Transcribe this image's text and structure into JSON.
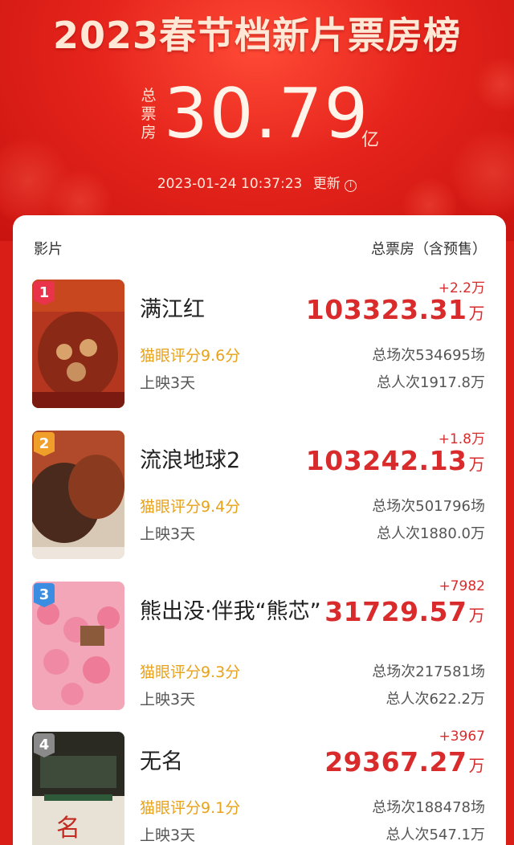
{
  "header": {
    "title": "2023春节档新片票房榜",
    "total_label": "总票房",
    "total_value": "30.79",
    "total_unit": "亿",
    "timestamp": "2023-01-24  10:37:23",
    "update_label": "更新",
    "info_glyph": "i"
  },
  "table": {
    "col_film": "影片",
    "col_box": "总票房（含预售）"
  },
  "movies": [
    {
      "rank": "1",
      "name": "满江红",
      "rating": "猫眼评分9.6分",
      "days": "上映3天",
      "delta": "+2.2万",
      "box": "103323.31",
      "box_unit": "万",
      "showings": "总场次534695场",
      "admissions": "总人次1917.8万",
      "badge_color": "#e8334a"
    },
    {
      "rank": "2",
      "name": "流浪地球2",
      "rating": "猫眼评分9.4分",
      "days": "上映3天",
      "delta": "+1.8万",
      "box": "103242.13",
      "box_unit": "万",
      "showings": "总场次501796场",
      "admissions": "总人次1880.0万",
      "badge_color": "#f0a02a"
    },
    {
      "rank": "3",
      "name": "熊出没·伴我“熊芯”",
      "rating": "猫眼评分9.3分",
      "days": "上映3天",
      "delta": "+7982",
      "box": "31729.57",
      "box_unit": "万",
      "showings": "总场次217581场",
      "admissions": "总人次622.2万",
      "badge_color": "#3a8de0"
    },
    {
      "rank": "4",
      "name": "无名",
      "rating": "猫眼评分9.1分",
      "days": "上映3天",
      "delta": "+3967",
      "box": "29367.27",
      "box_unit": "万",
      "showings": "总场次188478场",
      "admissions": "总人次547.1万",
      "badge_color": "#8a8a8a"
    }
  ]
}
